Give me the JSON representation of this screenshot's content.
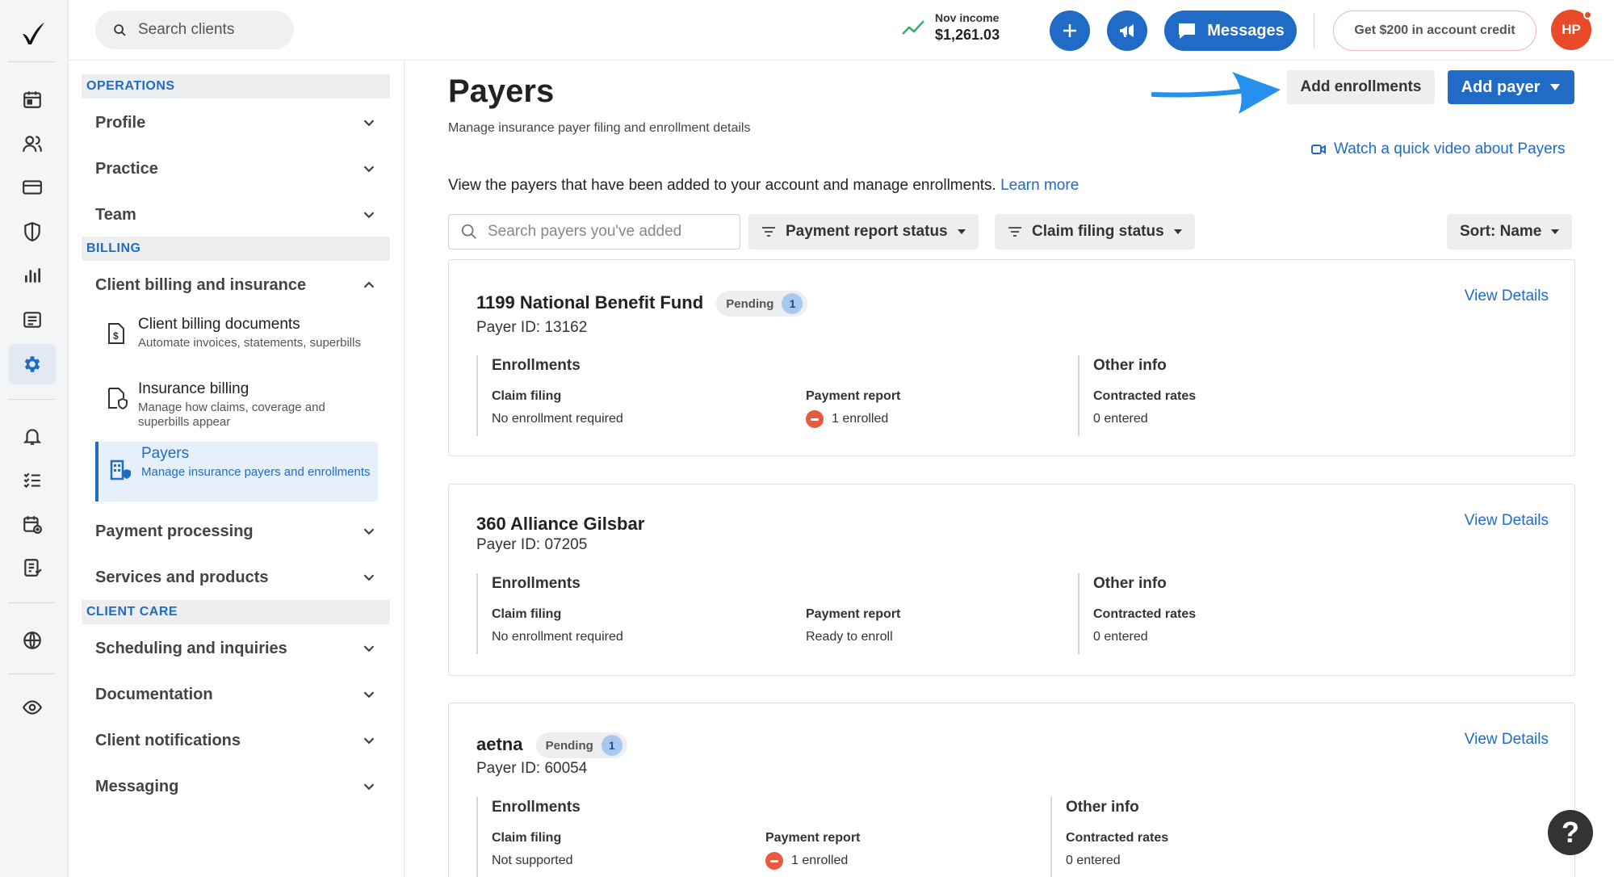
{
  "search": {
    "placeholder": "Search clients"
  },
  "income": {
    "label": "Nov income",
    "value": "$1,261.03"
  },
  "topbar": {
    "messages_label": "Messages",
    "credit_label": "Get $200 in account credit",
    "avatar_initials": "HP"
  },
  "sidenav": {
    "sections": [
      "OPERATIONS",
      "BILLING",
      "CLIENT CARE"
    ],
    "operations": [
      "Profile",
      "Practice",
      "Team"
    ],
    "billing_group": "Client billing and insurance",
    "billing_sub": [
      {
        "title": "Client billing documents",
        "desc": "Automate invoices, statements, superbills"
      },
      {
        "title": "Insurance billing",
        "desc": "Manage how claims, coverage and superbills appear"
      },
      {
        "title": "Payers",
        "desc": "Manage insurance payers and enrollments"
      }
    ],
    "billing_more": [
      "Payment processing",
      "Services and products"
    ],
    "client_care": [
      "Scheduling and inquiries",
      "Documentation",
      "Client notifications",
      "Messaging"
    ]
  },
  "page": {
    "title": "Payers",
    "subtitle": "Manage insurance payer filing and enrollment details",
    "add_enrollments": "Add enrollments",
    "add_payer": "Add payer",
    "video_link": "Watch a quick video about Payers",
    "intro": "View the payers that have been added to your account and manage enrollments.",
    "learn_more": "Learn more",
    "payer_search_placeholder": "Search payers you've added",
    "filters": [
      "Payment report status",
      "Claim filing status"
    ],
    "sort": "Sort: Name"
  },
  "labels": {
    "enrollments": "Enrollments",
    "other_info": "Other info",
    "claim_filing": "Claim filing",
    "payment_report": "Payment report",
    "contracted_rates": "Contracted rates",
    "view_details": "View Details"
  },
  "payers": [
    {
      "name": "1199 National Benefit Fund",
      "badge": "Pending",
      "badge_count": "1",
      "payer_id": "Payer ID: 13162",
      "claim_filing": "No enrollment required",
      "payment_report": "1 enrolled",
      "contracted_rates": "0 entered"
    },
    {
      "name": "360 Alliance Gilsbar",
      "payer_id": "Payer ID: 07205",
      "claim_filing": "No enrollment required",
      "payment_report": "Ready to enroll",
      "contracted_rates": "0 entered"
    },
    {
      "name": "aetna",
      "badge": "Pending",
      "badge_count": "1",
      "payer_id": "Payer ID: 60054",
      "claim_filing": "Not supported",
      "payment_report": "1 enrolled",
      "contracted_rates": "0 entered"
    }
  ],
  "help": "?",
  "colors": {
    "accent": "#1f6bc6",
    "alert": "#e85a40",
    "avatar": "#e94b2a"
  }
}
